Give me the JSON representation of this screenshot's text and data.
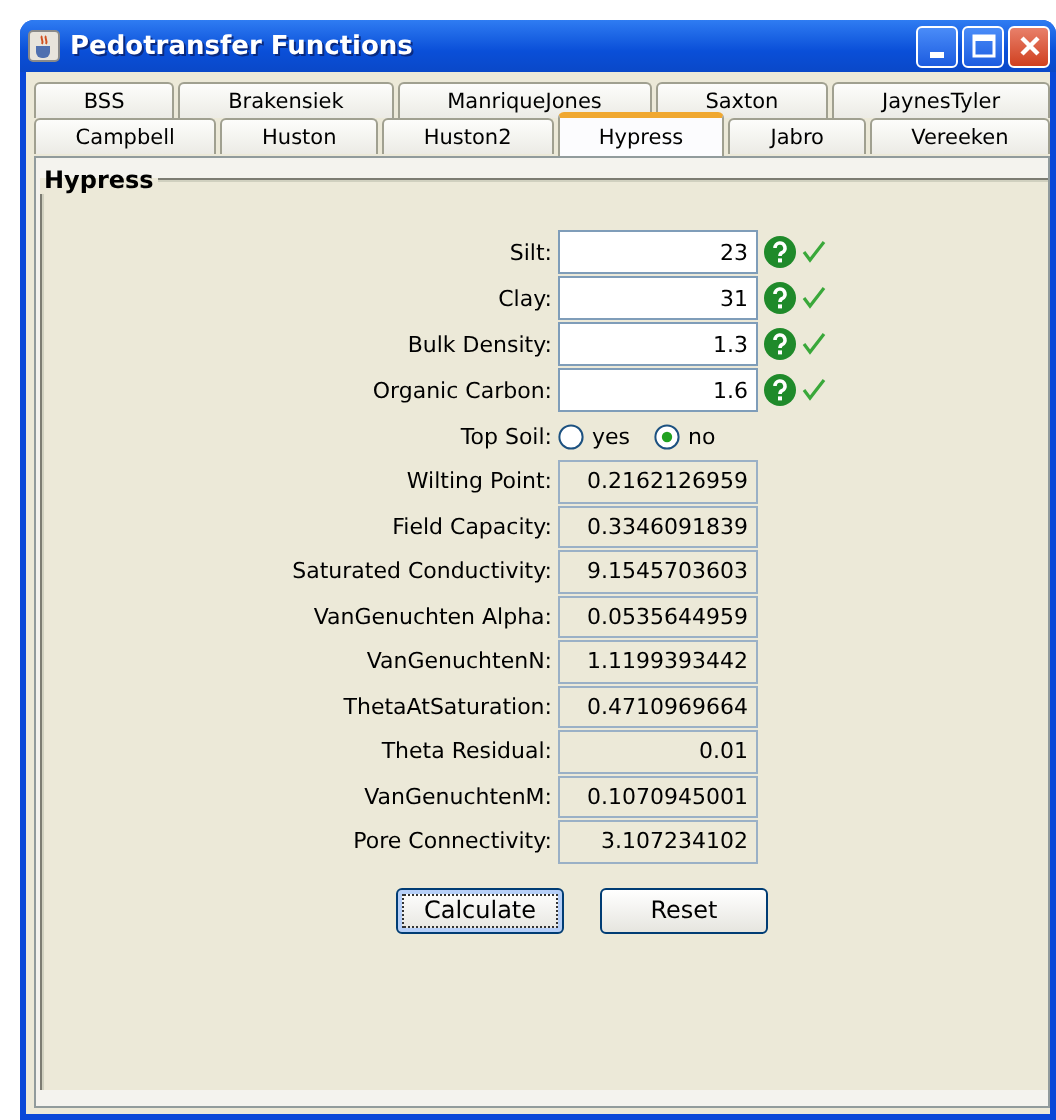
{
  "window": {
    "title": "Pedotransfer Functions"
  },
  "tab_rows": [
    [
      {
        "label": "BSS",
        "selected": false
      },
      {
        "label": "Brakensiek",
        "selected": false
      },
      {
        "label": "ManriqueJones",
        "selected": false
      },
      {
        "label": "Saxton",
        "selected": false
      },
      {
        "label": "JaynesTyler",
        "selected": false
      }
    ],
    [
      {
        "label": "Campbell",
        "selected": false
      },
      {
        "label": "Huston",
        "selected": false
      },
      {
        "label": "Huston2",
        "selected": false
      },
      {
        "label": "Hypress",
        "selected": true
      },
      {
        "label": "Jabro",
        "selected": false
      },
      {
        "label": "Vereeken",
        "selected": false
      }
    ]
  ],
  "panel": {
    "title": "Hypress"
  },
  "inputs": [
    {
      "label": "Silt:",
      "value": "23",
      "valid": true
    },
    {
      "label": "Clay:",
      "value": "31",
      "valid": true
    },
    {
      "label": "Bulk Density:",
      "value": "1.3",
      "valid": true
    },
    {
      "label": "Organic Carbon:",
      "value": "1.6",
      "valid": true
    }
  ],
  "top_soil": {
    "label": "Top Soil:",
    "options": [
      {
        "label": "yes",
        "selected": false
      },
      {
        "label": "no",
        "selected": true
      }
    ]
  },
  "outputs": [
    {
      "label": "Wilting Point:",
      "value": "0.2162126959"
    },
    {
      "label": "Field Capacity:",
      "value": "0.3346091839"
    },
    {
      "label": "Saturated Conductivity:",
      "value": "9.1545703603"
    },
    {
      "label": "VanGenuchten Alpha:",
      "value": "0.0535644959"
    },
    {
      "label": "VanGenuchtenN:",
      "value": "1.1199393442"
    },
    {
      "label": "ThetaAtSaturation:",
      "value": "0.4710969664"
    },
    {
      "label": "Theta Residual:",
      "value": "0.01"
    },
    {
      "label": "VanGenuchtenM:",
      "value": "0.1070945001"
    },
    {
      "label": "Pore Connectivity:",
      "value": "3.107234102"
    }
  ],
  "buttons": [
    {
      "label": "Calculate",
      "focused": true
    },
    {
      "label": "Reset",
      "focused": false
    }
  ]
}
